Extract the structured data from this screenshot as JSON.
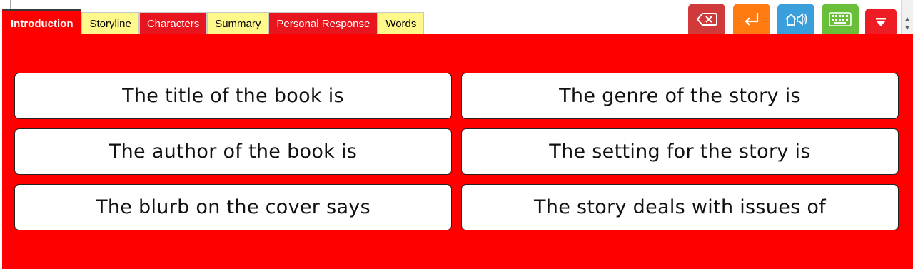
{
  "tabs": [
    {
      "label": "Introduction",
      "active": true,
      "color": "#ff0000"
    },
    {
      "label": "Storyline",
      "active": false,
      "color": "#fff88a"
    },
    {
      "label": "Characters",
      "active": false,
      "color": "#e8141e"
    },
    {
      "label": "Summary",
      "active": false,
      "color": "#fff88a"
    },
    {
      "label": "Personal Response",
      "active": false,
      "color": "#e8141e"
    },
    {
      "label": "Words",
      "active": false,
      "color": "#fff88a"
    }
  ],
  "toolbar": {
    "buttons": [
      {
        "icon": "backspace-icon",
        "color": "#d03a3a"
      },
      {
        "icon": "enter-icon",
        "color": "#ff7a10"
      },
      {
        "icon": "speak-icon",
        "color": "#3aa0dc"
      },
      {
        "icon": "keyboard-icon",
        "color": "#6abf3a"
      },
      {
        "icon": "collapse-icon",
        "color": "#ee1c25"
      }
    ]
  },
  "sentence_starters": [
    "The title of the book is",
    "The genre of the story is",
    "The author of the book is",
    "The setting for the story is",
    "The blurb on the cover says",
    "The story deals with issues of"
  ],
  "colors": {
    "panel": "#ff0000",
    "card": "#ffffff"
  }
}
